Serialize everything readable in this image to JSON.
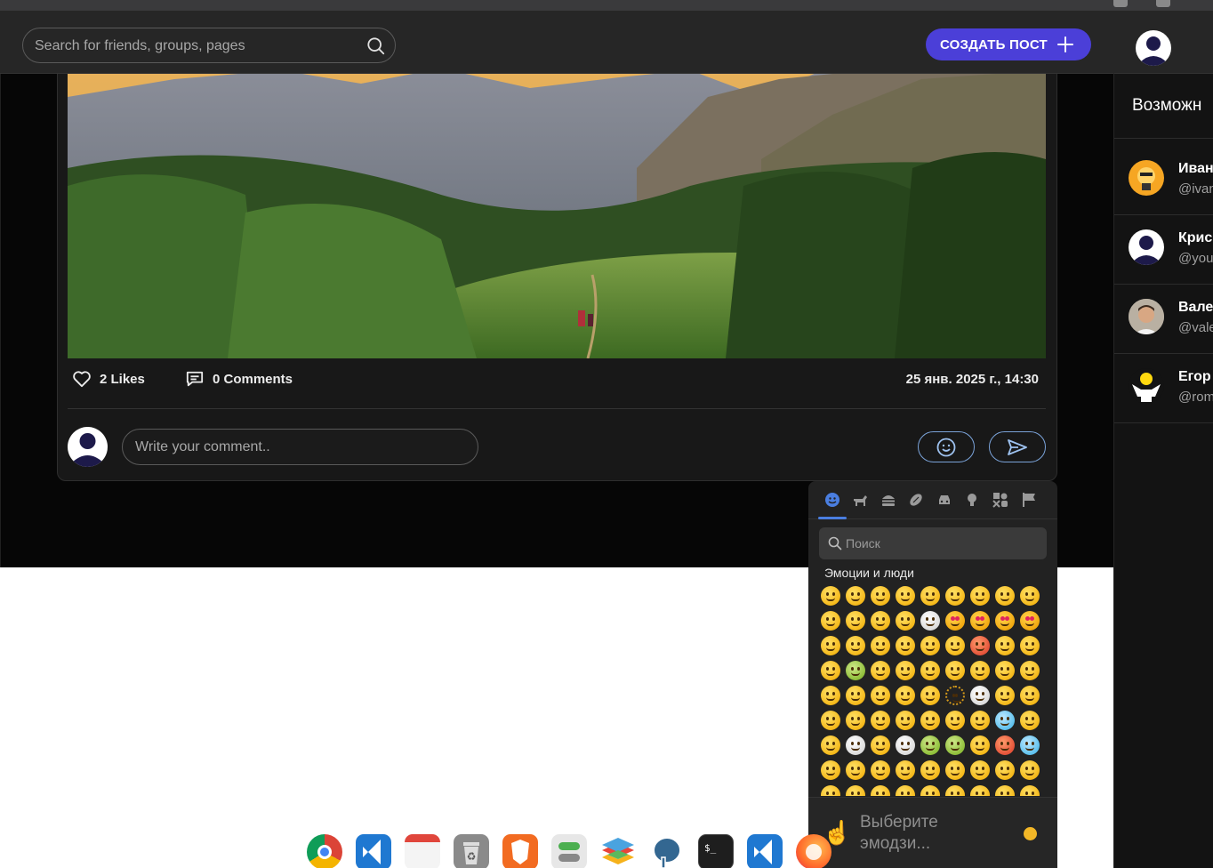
{
  "header": {
    "search_placeholder": "Search for friends, groups, pages",
    "create_post_label": "СОЗДАТЬ ПОСТ"
  },
  "sidebar": {
    "title": "Возможн",
    "suggestions": [
      {
        "name": "Иван",
        "handle": "@ivan"
      },
      {
        "name": "Крис",
        "handle": "@you"
      },
      {
        "name": "Вале",
        "handle": "@vale"
      },
      {
        "name": "Егор",
        "handle": "@rom"
      }
    ]
  },
  "post": {
    "likes": "2 Likes",
    "comments": "0 Comments",
    "date": "25 янв. 2025 г., 14:30",
    "comment_placeholder": "Write your comment.."
  },
  "emoji_picker": {
    "categories": [
      "smileys-icon",
      "animals-icon",
      "food-icon",
      "activity-icon",
      "travel-icon",
      "objects-icon",
      "symbols-icon",
      "flags-icon"
    ],
    "search_placeholder": "Поиск",
    "group_title": "Эмоции и люди",
    "footer_text": "Выберите эмодзи..."
  },
  "dock": {
    "apps": [
      "chrome-icon",
      "vscode-icon",
      "calendar-icon",
      "trash-icon",
      "brave-icon",
      "toggle-app-icon",
      "layers-app-icon",
      "postgres-icon",
      "terminal-icon",
      "vscode-icon",
      "firefox-icon"
    ]
  },
  "colors": {
    "accent": "#4b3fd8",
    "background": "#060606",
    "panel": "#262626",
    "card": "#181818",
    "link_outline": "#7aa2d8"
  }
}
